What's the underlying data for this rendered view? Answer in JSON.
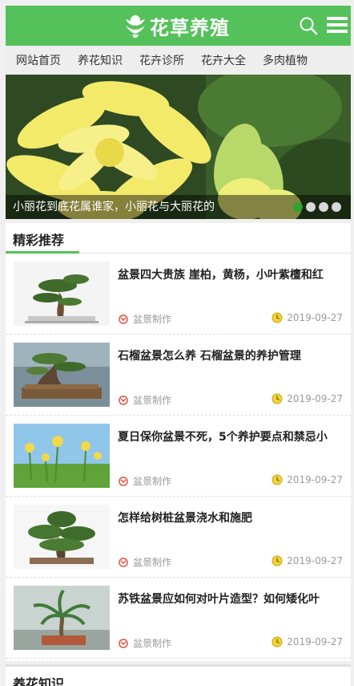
{
  "header": {
    "logo_text": "花草养殖",
    "colors": {
      "brand": "#55c15a",
      "accent_dark": "#2ea32e"
    },
    "icons": [
      "lotus-logo-icon",
      "search-icon",
      "menu-icon"
    ]
  },
  "nav": {
    "items": [
      "网站首页",
      "养花知识",
      "花卉诊所",
      "花卉大全",
      "多肉植物"
    ]
  },
  "banner": {
    "caption": "小丽花到底花属谁家，小丽花与大丽花的",
    "slide_count": 4,
    "active_slide": 1
  },
  "recommend": {
    "title": "精彩推荐",
    "articles": [
      {
        "title": "盆景四大贵族 崖柏，黄杨，小叶紫檀和红",
        "category": "盆景制作",
        "date": "2019-09-27"
      },
      {
        "title": "石榴盆景怎么养 石榴盆景的养护管理",
        "category": "盆景制作",
        "date": "2019-09-27"
      },
      {
        "title": "夏日保你盆景不死，5个养护要点和禁忌小",
        "category": "盆景制作",
        "date": "2019-09-27"
      },
      {
        "title": "怎样给树桩盆景浇水和施肥",
        "category": "盆景制作",
        "date": "2019-09-27"
      },
      {
        "title": "苏铁盆景应如何对叶片造型？如何矮化叶",
        "category": "盆景制作",
        "date": "2019-09-27"
      }
    ]
  },
  "next_section": {
    "title": "养花知识"
  }
}
